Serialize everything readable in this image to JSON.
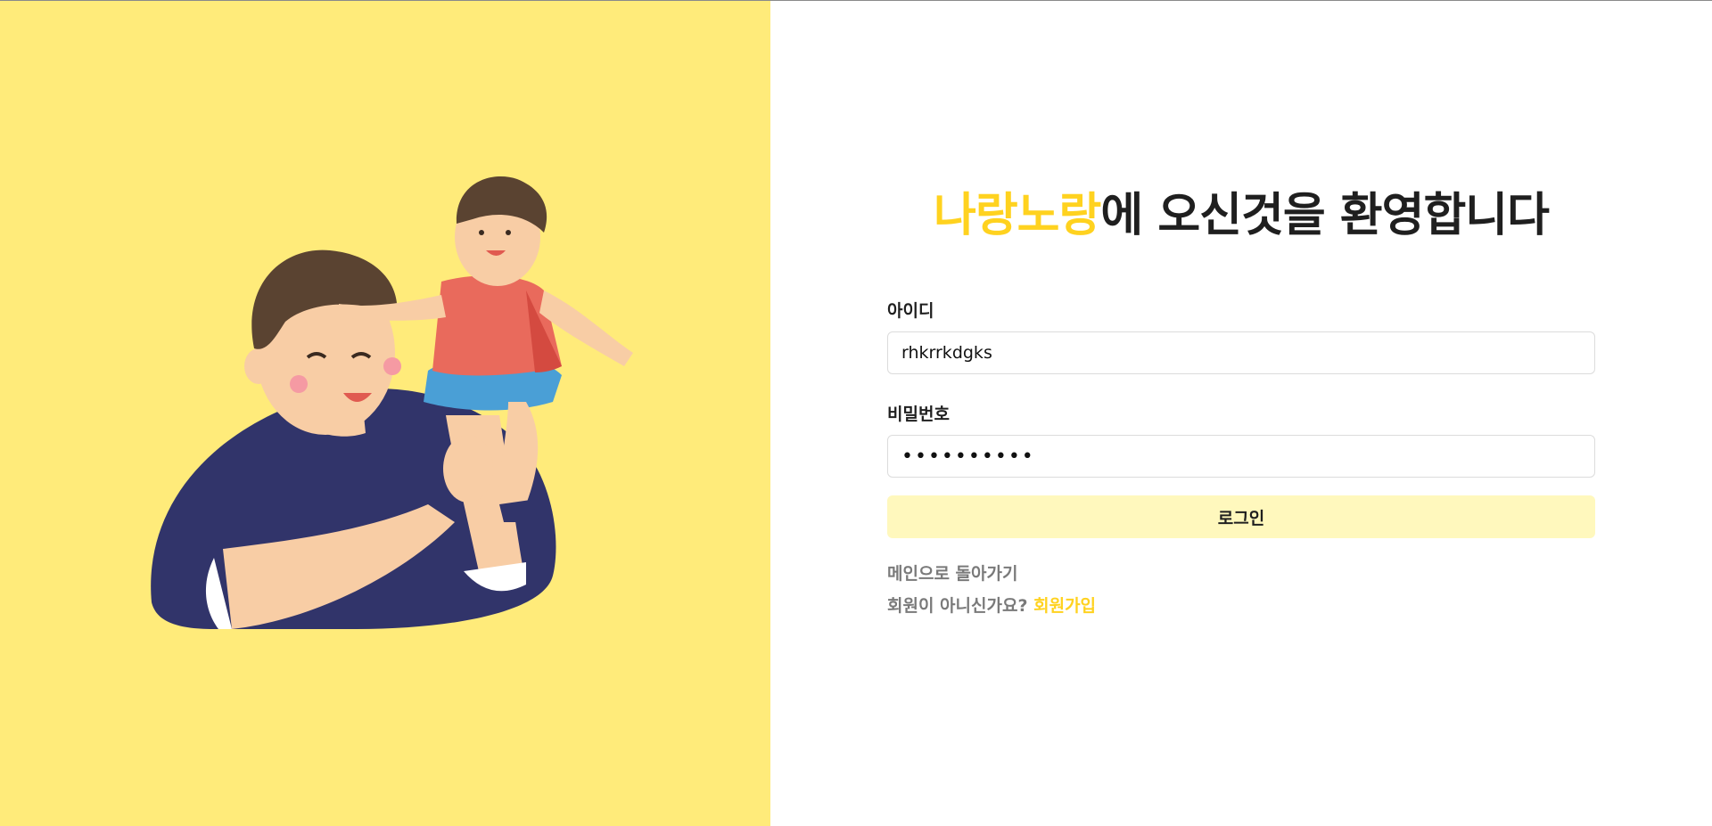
{
  "welcome": {
    "brand": "나랑노랑",
    "rest": "에 오신것을 환영합니다"
  },
  "form": {
    "id_label": "아이디",
    "id_value": "rhkrrkdgks",
    "password_label": "비밀번호",
    "password_value": "••••••••••",
    "login_label": "로그인"
  },
  "links": {
    "back_to_main": "메인으로 돌아가기",
    "not_member": "회원이 아니신가요?",
    "signup": "회원가입"
  },
  "colors": {
    "left_panel_bg": "#ffeb7a",
    "brand_yellow": "#ffd21f",
    "login_button_bg": "#fff8bd"
  },
  "illustration": "father-lifting-child-illustration"
}
